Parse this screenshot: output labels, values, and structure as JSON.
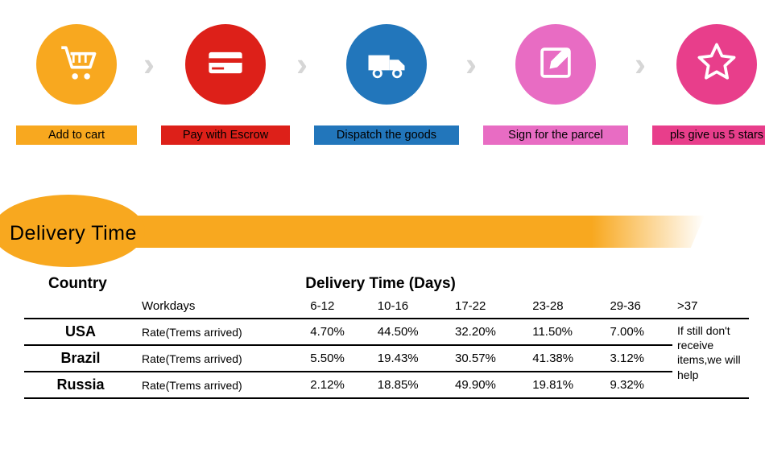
{
  "steps": [
    {
      "label": "Add to cart",
      "icon": "cart-icon",
      "circle": "c-orange",
      "labelClass": "l-orange"
    },
    {
      "label": "Pay with Escrow",
      "icon": "card-icon",
      "circle": "c-red",
      "labelClass": "l-red"
    },
    {
      "label": "Dispatch the goods",
      "icon": "truck-icon",
      "circle": "c-blue",
      "labelClass": "l-blue"
    },
    {
      "label": "Sign for the parcel",
      "icon": "sign-icon",
      "circle": "c-pink",
      "labelClass": "l-pink"
    },
    {
      "label": "pls give us 5 stars",
      "icon": "star-icon",
      "circle": "c-hotpink",
      "labelClass": "l-hotpink"
    }
  ],
  "delivery_title": "Delivery Time",
  "table": {
    "header_country": "Country",
    "header_dt": "Delivery Time (Days)",
    "subheader_label": "Workdays",
    "rate_label": "Rate(Trems arrived)",
    "columns": [
      "6-12",
      "10-16",
      "17-22",
      "23-28",
      "29-36",
      ">37"
    ],
    "rows": [
      {
        "country": "USA",
        "rates": [
          "4.70%",
          "44.50%",
          "32.20%",
          "11.50%",
          "7.00%"
        ]
      },
      {
        "country": "Brazil",
        "rates": [
          "5.50%",
          "19.43%",
          "30.57%",
          "41.38%",
          "3.12%"
        ]
      },
      {
        "country": "Russia",
        "rates": [
          "2.12%",
          "18.85%",
          "49.90%",
          "19.81%",
          "9.32%"
        ]
      }
    ],
    "footnote": "If still don't receive items,we will help"
  },
  "chart_data": {
    "type": "table",
    "title": "Delivery Time (Days)",
    "rows_label": "Country",
    "columns_label": "Workdays",
    "columns": [
      "6-12",
      "10-16",
      "17-22",
      "23-28",
      "29-36"
    ],
    "series": [
      {
        "name": "USA",
        "values": [
          4.7,
          44.5,
          32.2,
          11.5,
          7.0
        ]
      },
      {
        "name": "Brazil",
        "values": [
          5.5,
          19.43,
          30.57,
          41.38,
          3.12
        ]
      },
      {
        "name": "Russia",
        "values": [
          2.12,
          18.85,
          49.9,
          19.81,
          9.32
        ]
      }
    ],
    "value_label": "Rate(Trems arrived)",
    "unit": "%",
    "extra_column_label": ">37",
    "footnote": "If still don't receive items,we will help"
  }
}
